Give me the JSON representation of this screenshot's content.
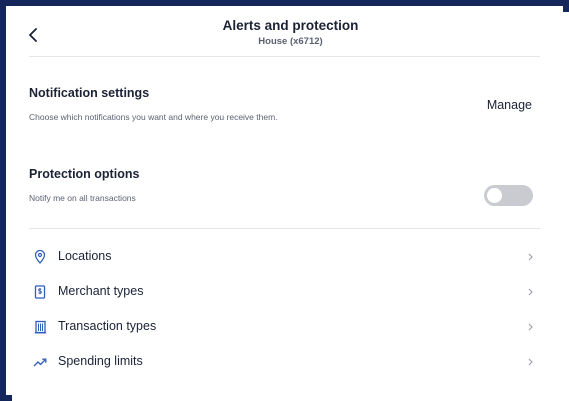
{
  "header": {
    "title": "Alerts and protection",
    "subtitle": "House (x6712)"
  },
  "notification_settings": {
    "title": "Notification settings",
    "description": "Choose which notifications you want and where you receive them.",
    "action_label": "Manage"
  },
  "protection_options": {
    "title": "Protection options",
    "description": "Notify me on all transactions",
    "toggle_on": false
  },
  "list": {
    "items": [
      {
        "label": "Locations",
        "icon": "location-pin-icon"
      },
      {
        "label": "Merchant types",
        "icon": "dollar-receipt-icon"
      },
      {
        "label": "Transaction types",
        "icon": "building-icon"
      },
      {
        "label": "Spending limits",
        "icon": "trending-up-icon"
      }
    ]
  },
  "colors": {
    "frame": "#15265a",
    "icon_accent": "#2f5fb6",
    "toggle_off": "#c9cbd0"
  }
}
